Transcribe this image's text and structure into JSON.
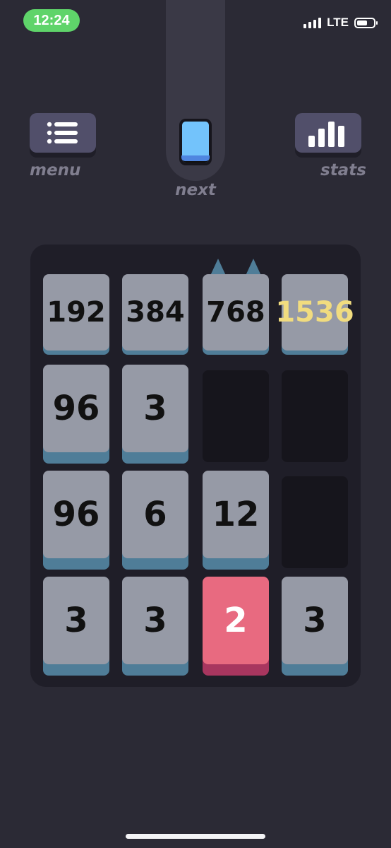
{
  "status_bar": {
    "time": "12:24",
    "network": "LTE"
  },
  "controls": {
    "menu_label": "menu",
    "stats_label": "stats",
    "next_label": "next",
    "next_card_color": "#73c3fb"
  },
  "board": {
    "rows": [
      [
        "192",
        "384",
        "768",
        "1536"
      ],
      [
        "96",
        "3",
        "",
        ""
      ],
      [
        "96",
        "6",
        "12",
        ""
      ],
      [
        "3",
        "3",
        "2",
        "3"
      ]
    ],
    "highlight_value": "1536",
    "highlight_color": "#f1dc7f",
    "red_tile_value": "2"
  }
}
